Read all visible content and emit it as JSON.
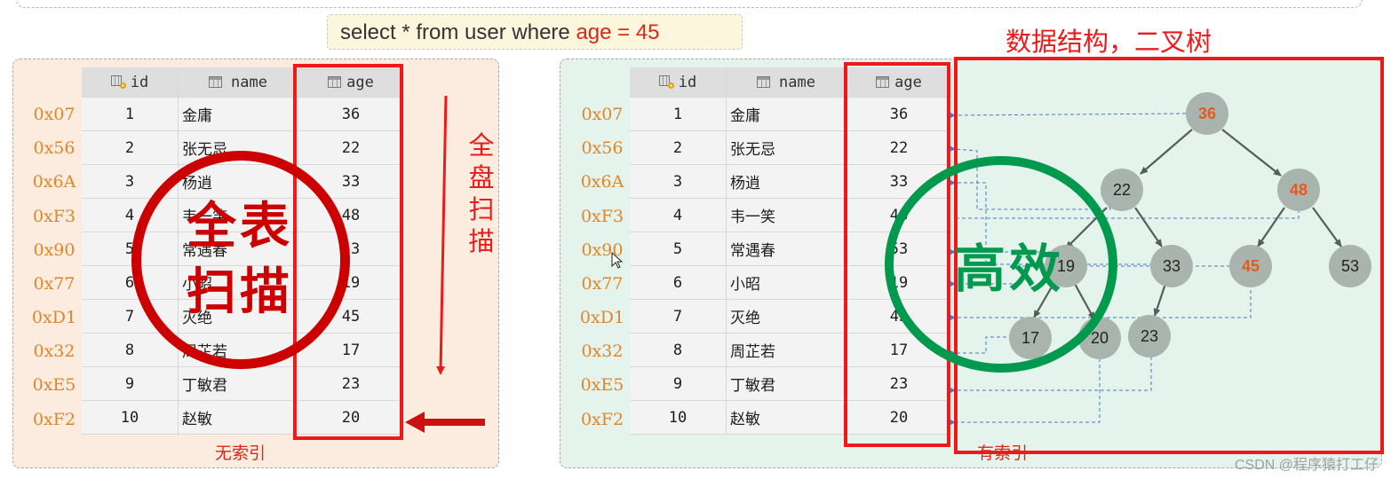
{
  "sql": {
    "prefix": "select * from user where ",
    "highlight": "age = 45"
  },
  "columns": {
    "id": "id",
    "name": "name",
    "age": "age"
  },
  "addresses": [
    "0x07",
    "0x56",
    "0x6A",
    "0xF3",
    "0x90",
    "0x77",
    "0xD1",
    "0x32",
    "0xE5",
    "0xF2"
  ],
  "rows": [
    {
      "id": "1",
      "name": "金庸",
      "age": "36"
    },
    {
      "id": "2",
      "name": "张无忌",
      "age": "22"
    },
    {
      "id": "3",
      "name": "杨逍",
      "age": "33"
    },
    {
      "id": "4",
      "name": "韦一笑",
      "age": "48"
    },
    {
      "id": "5",
      "name": "常遇春",
      "age": "53"
    },
    {
      "id": "6",
      "name": "小昭",
      "age": "19"
    },
    {
      "id": "7",
      "name": "灭绝",
      "age": "45"
    },
    {
      "id": "8",
      "name": "周芷若",
      "age": "17"
    },
    {
      "id": "9",
      "name": "丁敏君",
      "age": "23"
    },
    {
      "id": "10",
      "name": "赵敏",
      "age": "20"
    }
  ],
  "left_caption": "无索引",
  "right_caption": "有索引",
  "full_scan_label": "全盘扫描",
  "stamp_left": {
    "line1": "全表",
    "line2": "扫描"
  },
  "stamp_right": "高效",
  "tree_title": "数据结构，二叉树",
  "tree_nodes": [
    "36",
    "22",
    "48",
    "19",
    "33",
    "45",
    "53",
    "17",
    "20",
    "23"
  ],
  "highlighted_nodes": [
    "36",
    "48",
    "45"
  ],
  "watermark": "CSDN @程序猿打工仔",
  "colors": {
    "red": "#ee1a1a",
    "orange_address": "#e0862a",
    "stamp_red": "#cc0000",
    "stamp_green": "#00994d",
    "node": "#aab4ae",
    "link": "#4c78c8"
  }
}
